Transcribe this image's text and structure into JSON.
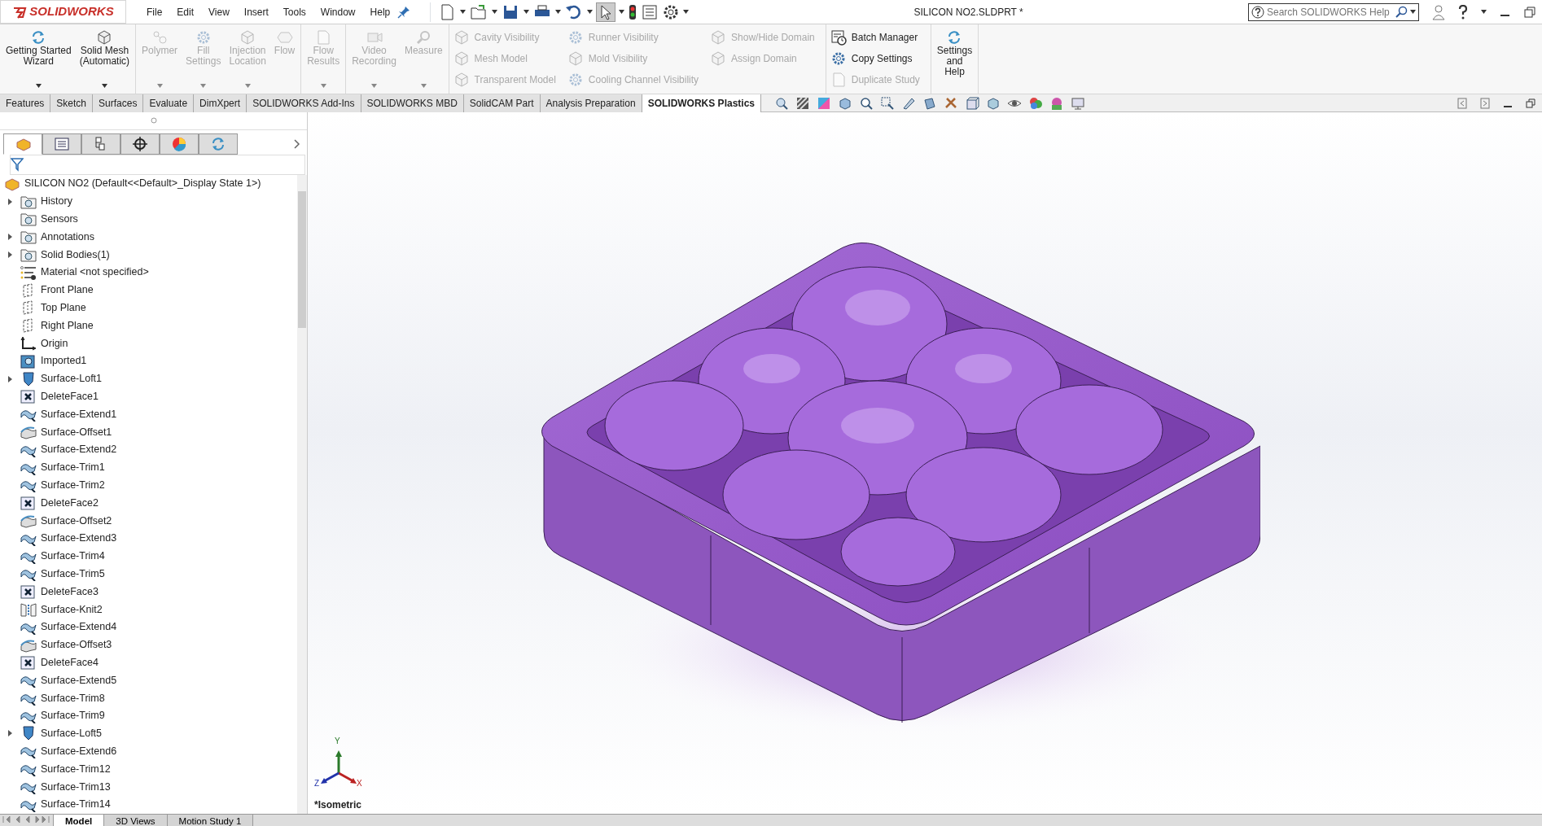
{
  "app": {
    "logo": "SOLIDWORKS"
  },
  "menu": [
    "File",
    "Edit",
    "View",
    "Insert",
    "Tools",
    "Window",
    "Help"
  ],
  "window": {
    "title": "SILICON NO2.SLDPRT *"
  },
  "search": {
    "placeholder": "Search SOLIDWORKS Help"
  },
  "ribbon": [
    {
      "kind": "large",
      "items": [
        {
          "label": "Getting Started\nWizard",
          "disabled": false,
          "dropdown": true
        },
        {
          "label": "Solid Mesh\n(Automatic)",
          "disabled": false,
          "dropdown": true
        }
      ]
    },
    {
      "kind": "large",
      "items": [
        {
          "label": "Polymer",
          "disabled": true,
          "dropdown": true
        },
        {
          "label": "Fill\nSettings",
          "disabled": true,
          "dropdown": true
        },
        {
          "label": "Injection\nLocation",
          "disabled": true,
          "dropdown": true
        },
        {
          "label": "Flow",
          "disabled": true,
          "dropdown": false
        }
      ]
    },
    {
      "kind": "large",
      "items": [
        {
          "label": "Flow\nResults",
          "disabled": true,
          "dropdown": true
        }
      ]
    },
    {
      "kind": "large",
      "items": [
        {
          "label": "Video\nRecording",
          "disabled": true,
          "dropdown": true
        },
        {
          "label": "Measure",
          "disabled": true,
          "dropdown": true
        }
      ]
    },
    {
      "kind": "small",
      "columns": [
        [
          {
            "label": "Cavity Visibility",
            "disabled": true
          },
          {
            "label": "Mesh Model",
            "disabled": true
          },
          {
            "label": "Transparent Model",
            "disabled": true
          }
        ],
        [
          {
            "label": "Runner Visibility",
            "disabled": true
          },
          {
            "label": "Mold Visibility",
            "disabled": true
          },
          {
            "label": "Cooling Channel Visibility",
            "disabled": true
          }
        ],
        [
          {
            "label": "Show/Hide Domain",
            "disabled": true
          },
          {
            "label": "Assign Domain",
            "disabled": true
          }
        ]
      ]
    },
    {
      "kind": "small",
      "columns": [
        [
          {
            "label": "Batch Manager",
            "disabled": false
          },
          {
            "label": "Copy Settings",
            "disabled": false
          },
          {
            "label": "Duplicate Study",
            "disabled": true
          }
        ]
      ]
    },
    {
      "kind": "large",
      "items": [
        {
          "label": "Settings\nand\nHelp",
          "disabled": false,
          "dropdown": false
        }
      ]
    }
  ],
  "command_tabs": [
    {
      "label": "Features",
      "selected": false
    },
    {
      "label": "Sketch",
      "selected": false
    },
    {
      "label": "Surfaces",
      "selected": false
    },
    {
      "label": "Evaluate",
      "selected": false
    },
    {
      "label": "DimXpert",
      "selected": false
    },
    {
      "label": "SOLIDWORKS Add-Ins",
      "selected": false
    },
    {
      "label": "SOLIDWORKS MBD",
      "selected": false
    },
    {
      "label": "SolidCAM Part",
      "selected": false
    },
    {
      "label": "Analysis Preparation",
      "selected": false
    },
    {
      "label": "SOLIDWORKS Plastics",
      "selected": true
    }
  ],
  "panel_tabs": [
    {
      "selected": true
    },
    {
      "selected": false
    },
    {
      "selected": false
    },
    {
      "selected": false
    },
    {
      "selected": false
    },
    {
      "selected": false
    }
  ],
  "tree": {
    "root": "SILICON NO2  (Default<<Default>_Display State 1>)",
    "items": [
      {
        "label": "History",
        "kind": "folder",
        "expandable": true
      },
      {
        "label": "Sensors",
        "kind": "folder",
        "expandable": false
      },
      {
        "label": "Annotations",
        "kind": "folder",
        "expandable": true
      },
      {
        "label": "Solid Bodies(1)",
        "kind": "folder",
        "expandable": true
      },
      {
        "label": "Material <not specified>",
        "kind": "material",
        "expandable": false
      },
      {
        "label": "Front Plane",
        "kind": "plane",
        "expandable": false
      },
      {
        "label": "Top Plane",
        "kind": "plane",
        "expandable": false
      },
      {
        "label": "Right Plane",
        "kind": "plane",
        "expandable": false
      },
      {
        "label": "Origin",
        "kind": "origin",
        "expandable": false
      },
      {
        "label": "Imported1",
        "kind": "imported",
        "expandable": false
      },
      {
        "label": "Surface-Loft1",
        "kind": "loft",
        "expandable": true
      },
      {
        "label": "DeleteFace1",
        "kind": "delete",
        "expandable": false
      },
      {
        "label": "Surface-Extend1",
        "kind": "surface",
        "expandable": false
      },
      {
        "label": "Surface-Offset1",
        "kind": "offset",
        "expandable": false
      },
      {
        "label": "Surface-Extend2",
        "kind": "surface",
        "expandable": false
      },
      {
        "label": "Surface-Trim1",
        "kind": "surface",
        "expandable": false
      },
      {
        "label": "Surface-Trim2",
        "kind": "surface",
        "expandable": false
      },
      {
        "label": "DeleteFace2",
        "kind": "delete",
        "expandable": false
      },
      {
        "label": "Surface-Offset2",
        "kind": "offset",
        "expandable": false
      },
      {
        "label": "Surface-Extend3",
        "kind": "surface",
        "expandable": false
      },
      {
        "label": "Surface-Trim4",
        "kind": "surface",
        "expandable": false
      },
      {
        "label": "Surface-Trim5",
        "kind": "surface",
        "expandable": false
      },
      {
        "label": "DeleteFace3",
        "kind": "delete",
        "expandable": false
      },
      {
        "label": "Surface-Knit2",
        "kind": "knit",
        "expandable": false
      },
      {
        "label": "Surface-Extend4",
        "kind": "surface",
        "expandable": false
      },
      {
        "label": "Surface-Offset3",
        "kind": "offset",
        "expandable": false
      },
      {
        "label": "DeleteFace4",
        "kind": "delete",
        "expandable": false
      },
      {
        "label": "Surface-Extend5",
        "kind": "surface",
        "expandable": false
      },
      {
        "label": "Surface-Trim8",
        "kind": "surface",
        "expandable": false
      },
      {
        "label": "Surface-Trim9",
        "kind": "surface",
        "expandable": false
      },
      {
        "label": "Surface-Loft5",
        "kind": "loft",
        "expandable": true
      },
      {
        "label": "Surface-Extend6",
        "kind": "surface",
        "expandable": false
      },
      {
        "label": "Surface-Trim12",
        "kind": "surface",
        "expandable": false
      },
      {
        "label": "Surface-Trim13",
        "kind": "surface",
        "expandable": false
      },
      {
        "label": "Surface-Trim14",
        "kind": "surface",
        "expandable": false
      }
    ]
  },
  "viewport": {
    "view_name": "*Isometric",
    "triad": {
      "x": "X",
      "y": "Y",
      "z": "Z"
    }
  },
  "bottom_tabs": [
    {
      "label": "Model",
      "selected": true
    },
    {
      "label": "3D Views",
      "selected": false
    },
    {
      "label": "Motion Study 1",
      "selected": false
    }
  ]
}
